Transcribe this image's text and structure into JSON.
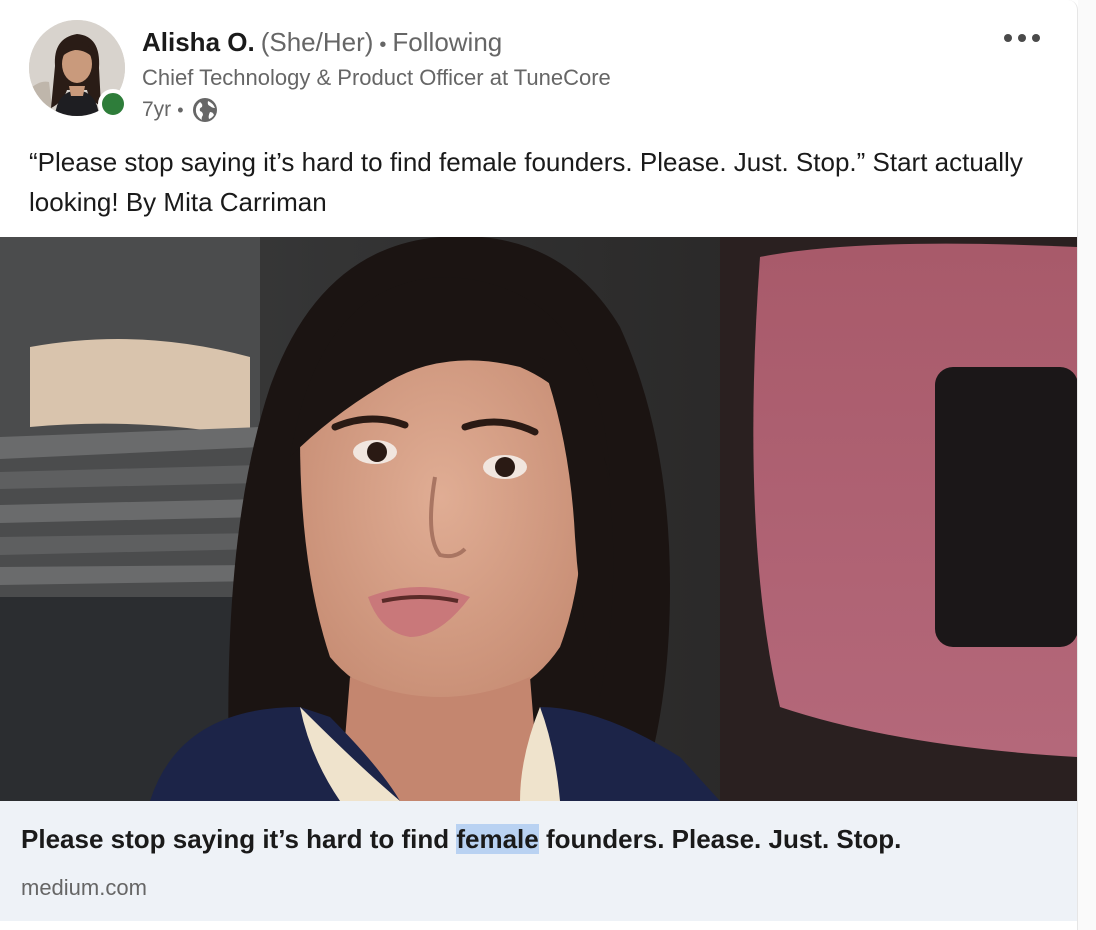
{
  "post": {
    "author": {
      "name": "Alisha O.",
      "pronouns": "(She/Her)",
      "connection_separator": "•",
      "connection": "Following",
      "headline": "Chief Technology & Product Officer at TuneCore",
      "age": "7yr",
      "age_separator": "•",
      "visibility_icon": "globe-icon",
      "presence_color": "#2e7d3a"
    },
    "commentary": "“Please stop saying it’s hard to find female founders. Please. Just. Stop.” Start actually looking! By Mita Carriman",
    "more_icon": "more-horizontal-icon",
    "link_preview": {
      "title_before": "Please stop saying it’s hard to find ",
      "title_highlight": "female",
      "title_after": " founders. Please. Just. Stop.",
      "source": "medium.com",
      "highlight_color": "#b9d2f2",
      "background_color": "#eef2f7"
    }
  }
}
